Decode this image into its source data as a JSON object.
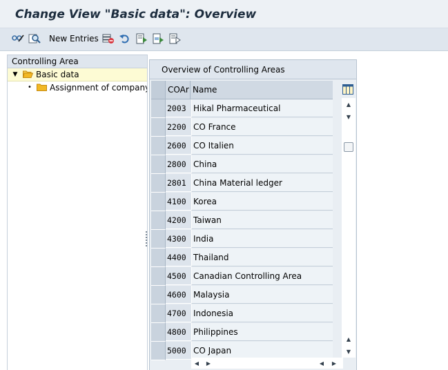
{
  "title": "Change View \"Basic data\": Overview",
  "toolbar": {
    "new_entries_label": "New Entries",
    "icons": [
      "display-change-icon",
      "find-icon",
      "delete-icon",
      "undo-icon",
      "select-all-icon",
      "select-block-icon",
      "deselect-all-icon"
    ]
  },
  "tree": {
    "header": "Controlling Area",
    "items": [
      {
        "label": "Basic data",
        "expanded": true,
        "selected": true
      },
      {
        "label": "Assignment of company code(s)",
        "expanded": false,
        "selected": false
      }
    ]
  },
  "panel": {
    "title": "Overview of Controlling Areas",
    "columns": [
      "COAr",
      "Name"
    ],
    "rows": [
      {
        "code": "2003",
        "name": "Hikal Pharmaceutical"
      },
      {
        "code": "2200",
        "name": "CO France"
      },
      {
        "code": "2600",
        "name": "CO Italien"
      },
      {
        "code": "2800",
        "name": "China"
      },
      {
        "code": "2801",
        "name": "China Material ledger"
      },
      {
        "code": "4100",
        "name": "Korea"
      },
      {
        "code": "4200",
        "name": "Taiwan"
      },
      {
        "code": "4300",
        "name": "India"
      },
      {
        "code": "4400",
        "name": "Thailand"
      },
      {
        "code": "4500",
        "name": "Canadian Controlling Area"
      },
      {
        "code": "4600",
        "name": "Malaysia"
      },
      {
        "code": "4700",
        "name": "Indonesia"
      },
      {
        "code": "4800",
        "name": "Philippines"
      },
      {
        "code": "5000",
        "name": "CO Japan"
      }
    ]
  },
  "colors": {
    "selected_tree_row": "#fdfbd4",
    "folder": "#f2b825",
    "header_bg": "#dfe6ee"
  }
}
